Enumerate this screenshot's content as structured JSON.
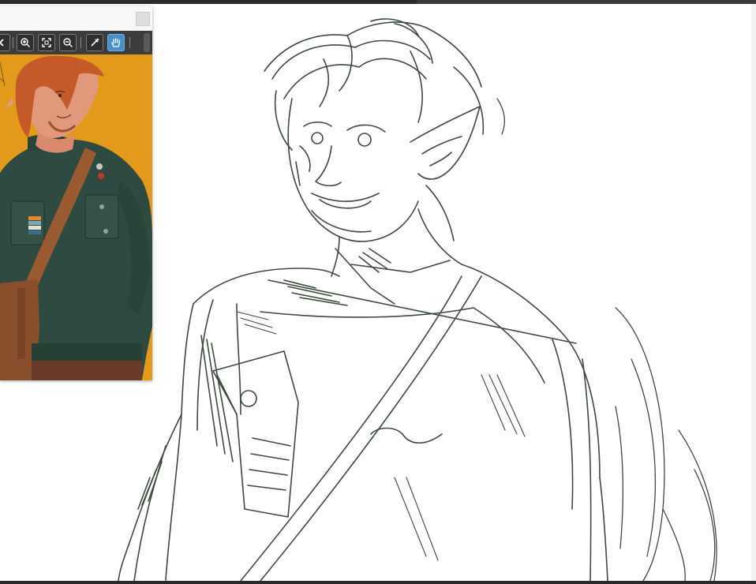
{
  "window": {
    "title": ""
  },
  "reference_panel": {
    "toolbar": {
      "buttons": [
        {
          "name": "back-arrow-icon",
          "active": false
        },
        {
          "name": "zoom-in-icon",
          "active": false
        },
        {
          "name": "fit-to-window-icon",
          "active": false
        },
        {
          "name": "zoom-out-icon",
          "active": false
        },
        {
          "name": "eyedropper-icon",
          "active": false
        },
        {
          "name": "hand-pan-icon",
          "active": true
        }
      ]
    },
    "image": {
      "background_color": "#e39a1a",
      "subject": "reference-illustration"
    }
  },
  "canvas": {
    "background_color": "#ffffff",
    "stroke_color": "#3d4a3d"
  },
  "colors": {
    "toolbar": "#3c3c3c",
    "accent": "#4a90c8"
  }
}
